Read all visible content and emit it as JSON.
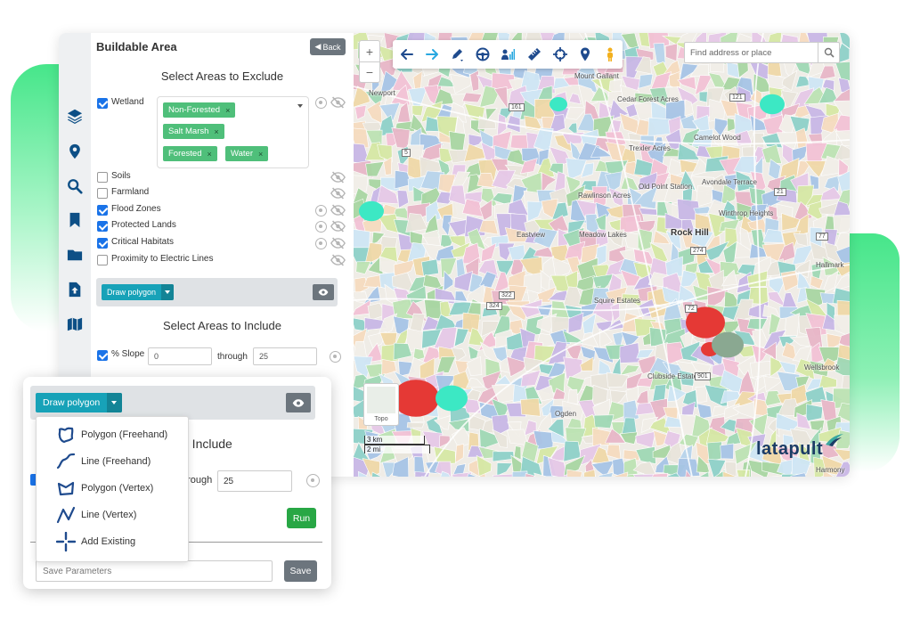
{
  "sidebar_icons": [
    "layers-icon",
    "location-pin-icon",
    "search-icon",
    "bookmark-icon",
    "folder-icon",
    "upload-icon",
    "map-icon"
  ],
  "panel": {
    "title": "Buildable Area",
    "back_label": "Back",
    "exclude_title": "Select Areas to Exclude",
    "include_title": "Select Areas to Include",
    "exclude_layers": [
      {
        "label": "Wetland",
        "checked": true
      },
      {
        "label": "Soils",
        "checked": false
      },
      {
        "label": "Farmland",
        "checked": false
      },
      {
        "label": "Flood Zones",
        "checked": true
      },
      {
        "label": "Protected Lands",
        "checked": true
      },
      {
        "label": "Critical Habitats",
        "checked": true
      },
      {
        "label": "Proximity to Electric Lines",
        "checked": false
      }
    ],
    "wetland_chips": [
      "Non-Forested",
      "Salt Marsh",
      "Forested",
      "Water"
    ],
    "chip_remove": "×",
    "draw_polygon_label": "Draw polygon",
    "slope": {
      "label": "% Slope",
      "checked": true,
      "from": "0",
      "through_label": "through",
      "to": "25"
    }
  },
  "map": {
    "search_placeholder": "Find address or place",
    "zoom_in": "+",
    "zoom_out": "−",
    "basemap_label": "Topo",
    "scale_km": "3 km",
    "scale_mi": "2 mi",
    "logo_text": "latapult",
    "toolbar_icons": [
      "back-arrow-icon",
      "forward-arrow-icon",
      "pencil-icon",
      "steering-wheel-icon",
      "person-chart-icon",
      "ruler-icon",
      "crosshair-icon",
      "location-pin-icon",
      "pegman-icon"
    ],
    "places": [
      {
        "name": "Rock Hill",
        "major": true
      },
      {
        "name": "Meadow Lakes",
        "major": false
      },
      {
        "name": "Old Point Station",
        "major": false
      },
      {
        "name": "Rawlinson Acres",
        "major": false
      },
      {
        "name": "Avondale Terrace",
        "major": false
      },
      {
        "name": "Winthrop Heights",
        "major": false
      },
      {
        "name": "Camelot Wood",
        "major": false
      },
      {
        "name": "Trexler Acres",
        "major": false
      },
      {
        "name": "Cedar Forest Acres",
        "major": false
      },
      {
        "name": "Squire Estates",
        "major": false
      },
      {
        "name": "Clubside Estates",
        "major": false
      },
      {
        "name": "Ogden",
        "major": false
      },
      {
        "name": "Wellsbrook",
        "major": false
      },
      {
        "name": "Hallmark",
        "major": false
      },
      {
        "name": "Eastview",
        "major": false
      },
      {
        "name": "Harmony",
        "major": false
      },
      {
        "name": "Mount Gallant",
        "major": false
      },
      {
        "name": "Newport",
        "major": false
      }
    ],
    "highways": [
      "161",
      "274",
      "901",
      "72",
      "322",
      "324",
      "5",
      "21",
      "77",
      "121"
    ]
  },
  "popup": {
    "draw_polygon_label": "Draw polygon",
    "menu_items": [
      {
        "label": "Polygon (Freehand)",
        "icon": "polygon-freehand-icon"
      },
      {
        "label": "Line (Freehand)",
        "icon": "line-freehand-icon"
      },
      {
        "label": "Polygon (Vertex)",
        "icon": "polygon-vertex-icon"
      },
      {
        "label": "Line (Vertex)",
        "icon": "line-vertex-icon"
      },
      {
        "label": "Add Existing",
        "icon": "add-existing-icon"
      }
    ],
    "include_fragment": "o Include",
    "through_fragment": "hrough",
    "to_value": "25",
    "run_label": "Run",
    "save_placeholder": "Save Parameters",
    "save_label": "Save"
  },
  "colors": {
    "accent_teal": "#17a2b8",
    "chip_green": "#4fbf7a",
    "run_green": "#28a745",
    "checkbox_blue": "#1a73e8",
    "icon_navy": "#0d4f86"
  }
}
